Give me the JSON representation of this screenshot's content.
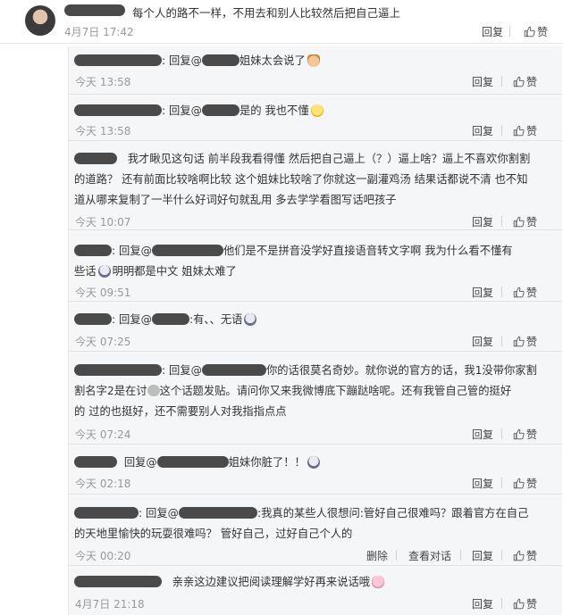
{
  "top": {
    "text": "每个人的路不一样，不用去和别人比较然后把自己逼上",
    "time": "4月7日 17:42",
    "reply": "回复",
    "like": "赞"
  },
  "replies": [
    {
      "prefix": ": 回复@",
      "line1": "姐妹太会说了",
      "time": "今天 13:58",
      "reply": "回复",
      "like": "赞"
    },
    {
      "prefix": ": 回复@",
      "line1": "是的 我也不懂",
      "time": "今天 13:58",
      "reply": "回复",
      "like": "赞"
    },
    {
      "line1": "我才瞅见这句话 前半段我看得懂 然后把自己逼上（？）逼上啥？逼上不喜欢你割割",
      "line2": "的道路？ 还有前面比较啥啊比较 这个姐妹比较啥了你就这一副灌鸡汤 结果话都说不清 也不知",
      "line3": "道从哪来复制了一半什么好词好句就乱用 多去学学看图写话吧孩子",
      "time": "今天 10:07",
      "reply": "回复",
      "like": "赞"
    },
    {
      "prefix": ": 回复@",
      "line1": "他们是不是拼音没学好直接语音转文字啊 我为什么看不懂有",
      "line2a": "些话",
      "line2b": "明明都是中文 姐妹太难了",
      "time": "今天 09:51",
      "reply": "回复",
      "like": "赞"
    },
    {
      "prefix": ": 回复@",
      "line1": ":有、、无语",
      "time": "今天 07:25",
      "reply": "回复",
      "like": "赞"
    },
    {
      "prefix": ": 回复@",
      "line1": "你的话很莫名奇妙。就你说的官方的话，我1没带你家割",
      "line2": "割名字2是在讨",
      "line2b": "这个话题发贴。请问你又来我微博底下蹦跶啥呢。还有我管自己管的挺好",
      "line3": "的 过的也挺好，还不需要别人对我指指点点",
      "time": "今天 07:24",
      "reply": "回复",
      "like": "赞"
    },
    {
      "prefix": "回复@",
      "line1": "姐妹你脏了！！",
      "time": "今天 02:18",
      "reply": "回复",
      "like": "赞"
    },
    {
      "prefix": ": 回复@",
      "line1": ":我真的某些人很想问:管好自己很难吗？跟着官方在自己",
      "line2": "的天地里愉快的玩耍很难吗？ 管好自己，过好自己个人的",
      "time": "今天 00:20",
      "delete": "删除",
      "view": "查看对话",
      "reply": "回复",
      "like": "赞"
    },
    {
      "line1": "亲亲这边建议把阅读理解学好再来说话哦",
      "time": "4月7日 21:18",
      "reply": "回复",
      "like": "赞"
    }
  ],
  "colors": {
    "link": "#eb7350",
    "time": "#999999",
    "panel": "#f5f6f7"
  },
  "icons": {
    "like": "thumbs-up-icon"
  }
}
